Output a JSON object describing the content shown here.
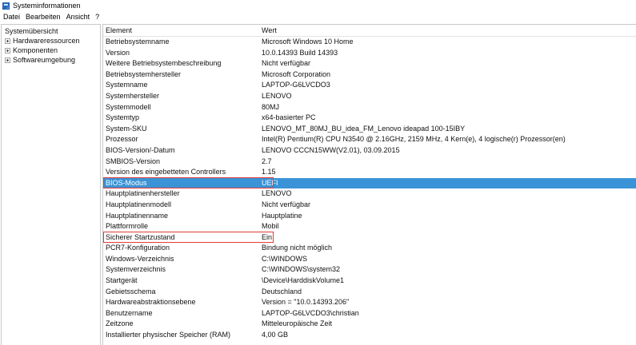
{
  "window": {
    "title": "Systeminformationen"
  },
  "menu": [
    "Datei",
    "Bearbeiten",
    "Ansicht",
    "?"
  ],
  "sidebar": {
    "root": "Systemübersicht",
    "nodes": [
      "Hardwareressourcen",
      "Komponenten",
      "Softwareumgebung"
    ]
  },
  "table": {
    "headers": {
      "element": "Element",
      "value": "Wert"
    },
    "selected_index": 16,
    "highlighted_indices": [
      16,
      21
    ],
    "rows": [
      {
        "element": "Betriebsystemname",
        "value": "Microsoft Windows 10 Home"
      },
      {
        "element": "Version",
        "value": "10.0.14393 Build 14393"
      },
      {
        "element": "Weitere Betriebsystembeschreibung",
        "value": "Nicht verfügbar"
      },
      {
        "element": "Betriebsystemhersteller",
        "value": "Microsoft Corporation"
      },
      {
        "element": "Systemname",
        "value": "LAPTOP-G6LVCDO3"
      },
      {
        "element": "Systemhersteller",
        "value": "LENOVO"
      },
      {
        "element": "Systemmodell",
        "value": "80MJ"
      },
      {
        "element": "Systemtyp",
        "value": "x64-basierter PC"
      },
      {
        "element": "System-SKU",
        "value": "LENOVO_MT_80MJ_BU_idea_FM_Lenovo ideapad 100-15IBY"
      },
      {
        "element": "Prozessor",
        "value": "Intel(R) Pentium(R) CPU  N3540  @ 2.16GHz, 2159 MHz, 4 Kern(e), 4 logische(r) Prozessor(en)"
      },
      {
        "element": "BIOS-Version/-Datum",
        "value": "LENOVO CCCN15WW(V2.01), 03.09.2015"
      },
      {
        "element": "SMBIOS-Version",
        "value": "2.7"
      },
      {
        "element": "Version des eingebetteten Controllers",
        "value": "1.15"
      },
      {
        "element": "BIOS-Modus",
        "value": "UEFI"
      },
      {
        "element": "Hauptplatinenhersteller",
        "value": "LENOVO"
      },
      {
        "element": "Hauptplatinenmodell",
        "value": "Nicht verfügbar"
      },
      {
        "element": "Hauptplatinenname",
        "value": "Hauptplatine"
      },
      {
        "element": "Plattformrolle",
        "value": "Mobil"
      },
      {
        "element": "Sicherer Startzustand",
        "value": "Ein"
      },
      {
        "element": "PCR7-Konfiguration",
        "value": "Bindung nicht möglich"
      },
      {
        "element": "Windows-Verzeichnis",
        "value": "C:\\WINDOWS"
      },
      {
        "element": "Systemverzeichnis",
        "value": "C:\\WINDOWS\\system32"
      },
      {
        "element": "Startgerät",
        "value": "\\Device\\HarddiskVolume1"
      },
      {
        "element": "Gebietsschema",
        "value": "Deutschland"
      },
      {
        "element": "Hardwareabstraktionsebene",
        "value": "Version = \"10.0.14393.206\""
      },
      {
        "element": "Benutzername",
        "value": "LAPTOP-G6LVCDO3\\christian"
      },
      {
        "element": "Zeitzone",
        "value": "Mitteleuropäische Zeit"
      },
      {
        "element": "Installierter physischer Speicher (RAM)",
        "value": "4,00 GB"
      }
    ]
  },
  "colors": {
    "selection": "#3a93d6",
    "highlight_border": "#e33b3b"
  }
}
